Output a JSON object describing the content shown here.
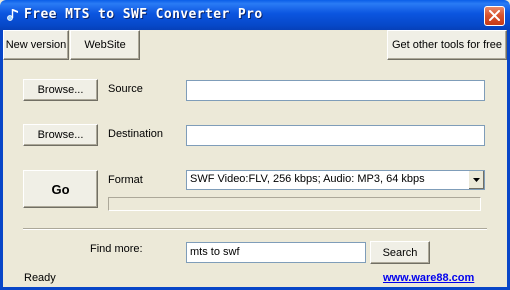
{
  "window": {
    "title": "Free MTS to SWF Converter Pro",
    "close_icon": "close-icon"
  },
  "toolbar": {
    "new_version": "New version",
    "website": "WebSite",
    "other_tools": "Get other tools for free"
  },
  "source": {
    "browse_label": "Browse...",
    "label": "Source",
    "value": ""
  },
  "destination": {
    "browse_label": "Browse...",
    "label": "Destination",
    "value": ""
  },
  "convert": {
    "go_label": "Go",
    "format_label": "Format",
    "format_value": "SWF Video:FLV, 256 kbps; Audio: MP3, 64 kbps",
    "progress": 0
  },
  "find_more": {
    "label": "Find more:",
    "value": "mts to swf",
    "search_label": "Search"
  },
  "status": {
    "text": "Ready",
    "link": "www.ware88.com"
  },
  "colors": {
    "titlebar": "#0b55e0",
    "window_bg": "#ece9d8",
    "link": "#0000ee"
  }
}
